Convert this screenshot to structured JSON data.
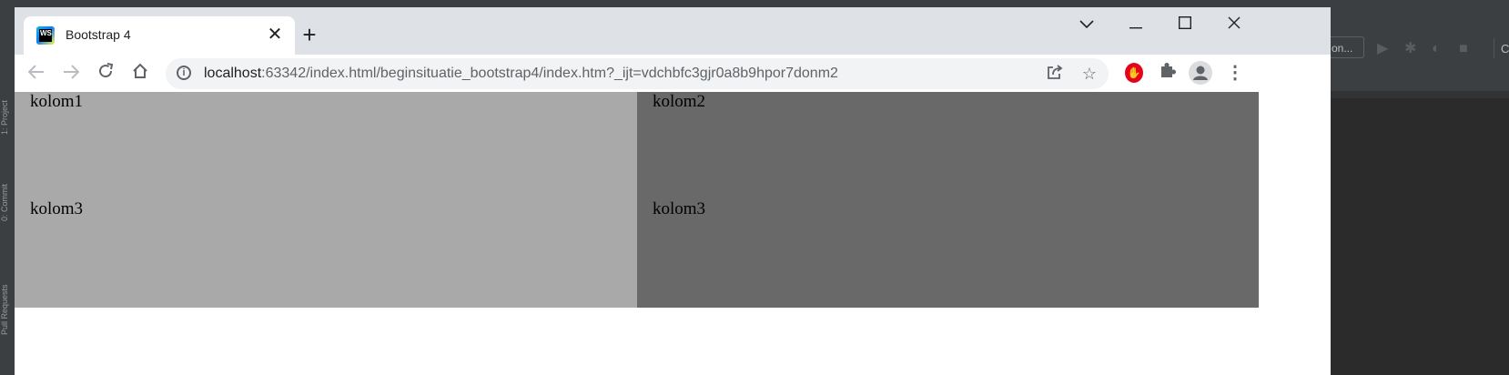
{
  "ide": {
    "side_tabs": [
      "1: Project",
      "0: Commit",
      "Pull Requests"
    ],
    "run_config_label": "on...",
    "overflow_char": "C"
  },
  "browser": {
    "tab": {
      "favicon_text": "WS",
      "title": "Bootstrap 4"
    },
    "address": {
      "host": "localhost",
      "rest": ":63342/index.html/beginsituatie_bootstrap4/index.htm?_ijt=vdchbfc3gjr0a8b9hpor7donm2"
    }
  },
  "page": {
    "col1": "kolom1",
    "col2": "kolom2",
    "col3_left": "kolom3",
    "col3_right": "kolom3"
  },
  "colors": {
    "left_column_bg": "#a9a9a9",
    "right_column_bg": "#696969"
  }
}
